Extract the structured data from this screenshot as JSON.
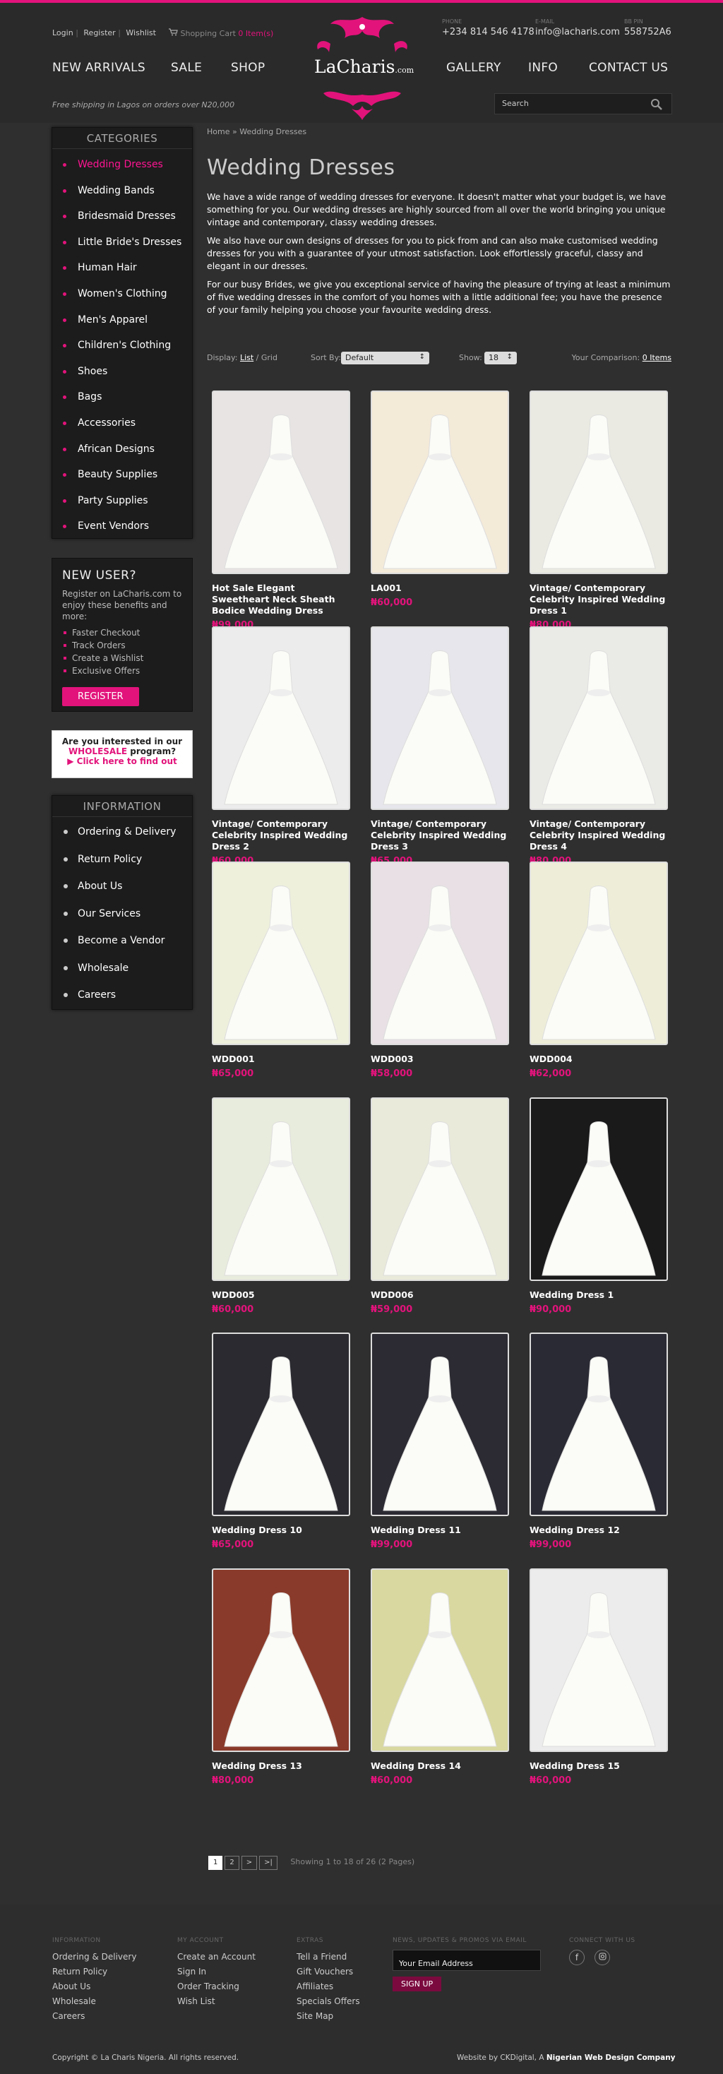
{
  "header": {
    "links": [
      "Login",
      "Register",
      "Wishlist"
    ],
    "cart_label": "Shopping Cart",
    "cart_count": "0 Item(s)",
    "phone_label": "PHONE",
    "phone": "+234 814 546 4178",
    "email_label": "E-MAIL",
    "email": "info@lacharis.com",
    "bb_label": "BB PIN",
    "bb": "558752A6",
    "logo_text": "LaCharis",
    "logo_suffix": ".com",
    "nav": [
      "NEW ARRIVALS",
      "SALE",
      "SHOP",
      "GALLERY",
      "INFO",
      "CONTACT US"
    ],
    "free_shipping": "Free shipping in Lagos on orders over N20,000",
    "search_placeholder": "Search"
  },
  "categories": {
    "title": "CATEGORIES",
    "items": [
      "Wedding Dresses",
      "Wedding Bands",
      "Bridesmaid Dresses",
      "Little Bride's Dresses",
      "Human Hair",
      "Women's Clothing",
      "Men's Apparel",
      "Children's Clothing",
      "Shoes",
      "Bags",
      "Accessories",
      "African Designs",
      "Beauty Supplies",
      "Party Supplies",
      "Event Vendors"
    ]
  },
  "new_user": {
    "title": "NEW USER?",
    "text": "Register on LaCharis.com to enjoy these benefits and more:",
    "benefits": [
      "Faster Checkout",
      "Track Orders",
      "Create a Wishlist",
      "Exclusive Offers"
    ],
    "button": "REGISTER"
  },
  "wholesale": {
    "line1": "Are you interested in our",
    "highlight": "WHOLESALE",
    "line2_rest": "program?",
    "line3": "▶ Click here to find out"
  },
  "information": {
    "title": "INFORMATION",
    "items": [
      "Ordering & Delivery",
      "Return Policy",
      "About Us",
      "Our Services",
      "Become a Vendor",
      "Wholesale",
      "Careers"
    ]
  },
  "main": {
    "breadcrumb": "Home » Wedding Dresses",
    "title": "Wedding Dresses",
    "paragraphs": [
      "We have a wide range of  wedding dresses for everyone. It doesn't matter what your budget is, we have something for you. Our wedding dresses are highly sourced from all over the world bringing you unique vintage and contemporary, classy wedding dresses.",
      "We also have our own designs of dresses for you to pick from and can also make customised wedding dresses for you with a guarantee of your utmost satisfaction. Look effortlessly graceful, classy and elegant in our dresses.",
      "For our busy Brides, we give you exceptional service of having the pleasure of trying at least a minimum of five wedding dresses in the comfort of you homes with a little additional fee; you have the presence of your family helping you choose your favourite wedding dress."
    ],
    "display_label": "Display:",
    "display_list": "List",
    "display_grid": "Grid",
    "sort_label": "Sort By:",
    "sort_value": "Default",
    "show_label": "Show:",
    "show_value": "18",
    "comparison_label": "Your Comparison:",
    "comparison_value": "0 Items"
  },
  "products": [
    {
      "name": "Hot Sale Elegant Sweetheart Neck Sheath Bodice Wedding Dress",
      "price": "₦99,000",
      "bg": "#e8e4e4"
    },
    {
      "name": "LA001",
      "price": "₦60,000",
      "bg": "#f4ead8"
    },
    {
      "name": "Vintage/ Contemporary Celebrity Inspired Wedding Dress 1",
      "price": "₦80,000",
      "bg": "#eaeae2"
    },
    {
      "name": "Vintage/ Contemporary Celebrity Inspired Wedding Dress 2",
      "price": "₦60,000",
      "bg": "#ececec"
    },
    {
      "name": "Vintage/ Contemporary Celebrity Inspired Wedding Dress 3",
      "price": "₦65,000",
      "bg": "#e6e6ec"
    },
    {
      "name": "Vintage/ Contemporary Celebrity Inspired Wedding Dress 4",
      "price": "₦80,000",
      "bg": "#eaebe6"
    },
    {
      "name": "WDD001",
      "price": "₦65,000",
      "bg": "#eef0dc"
    },
    {
      "name": "WDD003",
      "price": "₦58,000",
      "bg": "#e8e0e4"
    },
    {
      "name": "WDD004",
      "price": "₦62,000",
      "bg": "#eeeed8"
    },
    {
      "name": "WDD005",
      "price": "₦60,000",
      "bg": "#e8ecdc"
    },
    {
      "name": "WDD006",
      "price": "₦59,000",
      "bg": "#eaeada"
    },
    {
      "name": "Wedding Dress 1",
      "price": "₦90,000",
      "bg": "#1a1a1a"
    },
    {
      "name": "Wedding Dress 10",
      "price": "₦65,000",
      "bg": "#2a2a30"
    },
    {
      "name": "Wedding Dress 11",
      "price": "₦99,000",
      "bg": "#2c2a32"
    },
    {
      "name": "Wedding Dress 12",
      "price": "₦99,000",
      "bg": "#2a2a34"
    },
    {
      "name": "Wedding Dress 13",
      "price": "₦80,000",
      "bg": "#8a3a2a"
    },
    {
      "name": "Wedding Dress 14",
      "price": "₦60,000",
      "bg": "#d8d8a0"
    },
    {
      "name": "Wedding Dress 15",
      "price": "₦60,000",
      "bg": "#ececec"
    }
  ],
  "pagination": {
    "pages": [
      "1",
      "2",
      ">",
      ">|"
    ],
    "summary": "Showing 1 to 18 of 26 (2 Pages)"
  },
  "footer": {
    "information_title": "INFORMATION",
    "information": [
      "Ordering & Delivery",
      "Return Policy",
      "About Us",
      "Wholesale",
      "Careers"
    ],
    "account_title": "MY ACCOUNT",
    "account": [
      "Create an Account",
      "Sign In",
      "Order Tracking",
      "Wish List"
    ],
    "extras_title": "EXTRAS",
    "extras": [
      "Tell a Friend",
      "Gift Vouchers",
      "Affiliates",
      "Specials Offers",
      "Site Map"
    ],
    "news_title": "NEWS, UPDATES & PROMOS VIA EMAIL",
    "email_placeholder": "Your Email Address",
    "signup": "SIGN UP",
    "connect_title": "CONNECT WITH US",
    "copyright": "Copyright © La Charis Nigeria. All rights reserved.",
    "credit_prefix": "Website by CKDigital, A ",
    "credit_bold": "Nigerian Web Design Company"
  },
  "colors": {
    "accent": "#e2137b",
    "background": "#2f2f2f",
    "panel": "#1c1c1c"
  }
}
